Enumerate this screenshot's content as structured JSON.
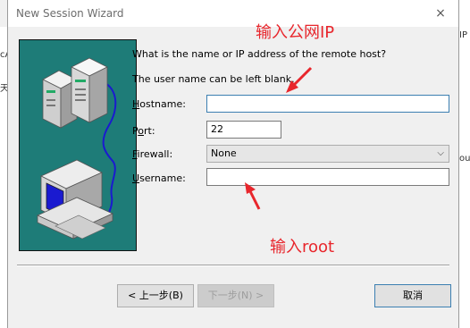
{
  "window": {
    "title": "New Session Wizard",
    "close_icon": "×"
  },
  "prompt": {
    "line1": "What is the name or IP address of the remote host?",
    "line2": "The user name can be left blank."
  },
  "fields": {
    "hostname": {
      "pre": "",
      "key": "H",
      "post": "ostname:",
      "value": ""
    },
    "port": {
      "pre": "P",
      "key": "o",
      "post": "rt:",
      "value": "22"
    },
    "firewall": {
      "pre": "",
      "key": "F",
      "post": "irewall:",
      "value": "None"
    },
    "username": {
      "pre": "",
      "key": "U",
      "post": "sername:",
      "value": ""
    }
  },
  "buttons": {
    "back": "< 上一步(B)",
    "next": "下一步(N) >",
    "cancel": "取消"
  },
  "annotations": {
    "hostname_note": "输入公网IP",
    "username_note": "输入root",
    "color": "#e8262c"
  },
  "background_fragments": {
    "left": [
      "cA",
      "天"
    ],
    "right": [
      "IP",
      "ou"
    ]
  },
  "colors": {
    "illustration_bg": "#1e7c78",
    "monitor_screen": "#1a1ad0"
  }
}
